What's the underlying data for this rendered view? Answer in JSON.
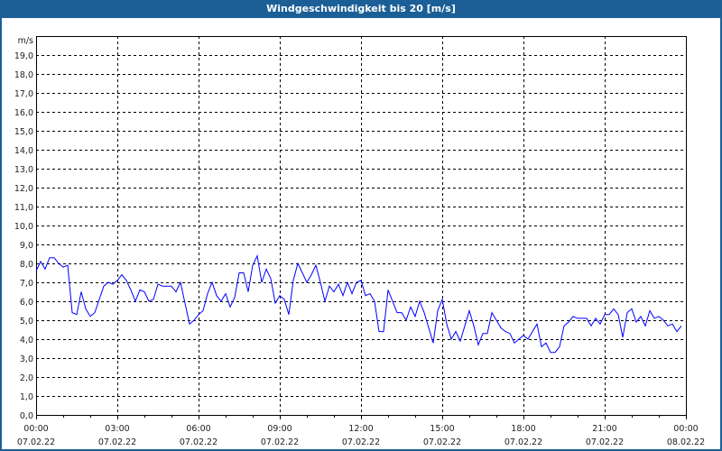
{
  "window": {
    "title": "Windgeschwindigkeit bis 20 [m/s]"
  },
  "colors": {
    "titlebar": "#1c5f96",
    "line": "#0000ff",
    "grid": "#000000"
  },
  "chart_data": {
    "type": "line",
    "title": "Windgeschwindigkeit bis 20 [m/s]",
    "ylabel": "m/s",
    "xlabel": "",
    "ylim": [
      0,
      20
    ],
    "grid": true,
    "yticks": [
      "0,0",
      "1,0",
      "2,0",
      "3,0",
      "4,0",
      "5,0",
      "6,0",
      "7,0",
      "8,0",
      "9,0",
      "10,0",
      "11,0",
      "12,0",
      "13,0",
      "14,0",
      "15,0",
      "16,0",
      "17,0",
      "18,0",
      "19,0"
    ],
    "xlim_hours": [
      0,
      24
    ],
    "xticks": [
      {
        "time": "00:00",
        "date": "07.02.22",
        "hour": 0
      },
      {
        "time": "03:00",
        "date": "07.02.22",
        "hour": 3
      },
      {
        "time": "06:00",
        "date": "07.02.22",
        "hour": 6
      },
      {
        "time": "09:00",
        "date": "07.02.22",
        "hour": 9
      },
      {
        "time": "12:00",
        "date": "07.02.22",
        "hour": 12
      },
      {
        "time": "15:00",
        "date": "07.02.22",
        "hour": 15
      },
      {
        "time": "18:00",
        "date": "07.02.22",
        "hour": 18
      },
      {
        "time": "21:00",
        "date": "07.02.22",
        "hour": 21
      },
      {
        "time": "00:00",
        "date": "08.02.22",
        "hour": 24
      }
    ],
    "interval_minutes": 10,
    "series": [
      {
        "name": "Windgeschwindigkeit",
        "values": [
          7.6,
          8.1,
          7.7,
          8.3,
          8.3,
          8.0,
          7.8,
          7.9,
          5.4,
          5.3,
          6.5,
          5.6,
          5.2,
          5.4,
          6.1,
          6.8,
          7.0,
          6.9,
          7.1,
          7.4,
          7.1,
          6.6,
          6.0,
          6.6,
          6.5,
          6.0,
          6.1,
          6.9,
          6.8,
          6.8,
          6.8,
          6.5,
          7.0,
          5.9,
          4.8,
          5.0,
          5.3,
          5.5,
          6.4,
          7.0,
          6.3,
          6.0,
          6.4,
          5.7,
          6.2,
          7.5,
          7.5,
          6.5,
          7.9,
          8.4,
          7.0,
          7.7,
          7.2,
          5.9,
          6.3,
          6.1,
          5.3,
          7.1,
          8.0,
          7.5,
          7.0,
          7.4,
          7.9,
          7.0,
          6.0,
          6.8,
          6.5,
          6.9,
          6.3,
          7.0,
          6.4,
          7.0,
          7.1,
          6.3,
          6.4,
          6.0,
          4.4,
          4.4,
          6.6,
          6.0,
          5.4,
          5.4,
          5.0,
          5.7,
          5.2,
          6.0,
          5.4,
          4.6,
          3.8,
          5.5,
          6.1,
          4.8,
          4.0,
          4.4,
          3.9,
          4.7,
          5.5,
          4.7,
          3.7,
          4.3,
          4.3,
          5.4,
          5.0,
          4.6,
          4.4,
          4.3,
          3.8,
          4.0,
          4.2,
          4.0,
          4.4,
          4.8,
          3.6,
          3.8,
          3.3,
          3.3,
          3.6,
          4.7,
          4.9,
          5.2,
          5.1,
          5.1,
          5.1,
          4.7,
          5.1,
          4.8,
          5.3,
          5.3,
          5.6,
          5.3,
          4.1,
          5.4,
          5.6,
          4.9,
          5.2,
          4.7,
          5.5,
          5.1,
          5.2,
          5.0,
          4.7,
          4.8,
          4.4,
          4.7
        ]
      }
    ]
  }
}
